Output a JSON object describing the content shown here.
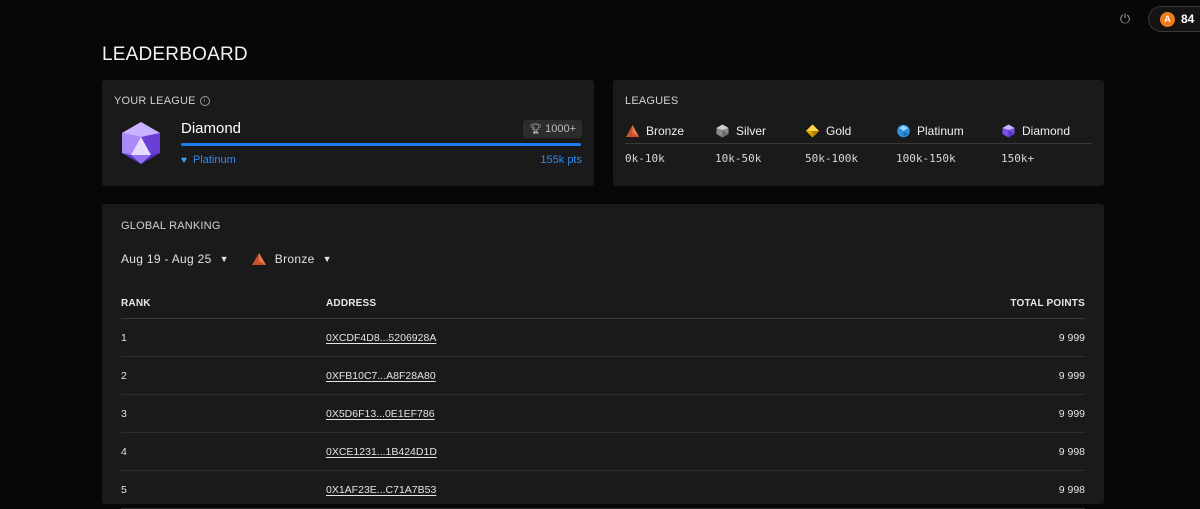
{
  "header": {
    "avatar_initial": "A",
    "balance_text": "84"
  },
  "page": {
    "title": "LEADERBOARD"
  },
  "your_league": {
    "label": "YOUR LEAGUE",
    "league_name": "Diamond",
    "badge": "1000+",
    "next_league": "Platinum",
    "points": "155k pts",
    "progress_percent": 100
  },
  "leagues": {
    "label": "LEAGUES",
    "items": [
      {
        "name": "Bronze",
        "range": "0k-10k",
        "icon": "bronze-triangle-icon",
        "color": "#d8603a"
      },
      {
        "name": "Silver",
        "range": "10k-50k",
        "icon": "silver-gem-icon",
        "color": "#9a9a9a"
      },
      {
        "name": "Gold",
        "range": "50k-100k",
        "icon": "gold-gem-icon",
        "color": "#f0b400"
      },
      {
        "name": "Platinum",
        "range": "100k-150k",
        "icon": "platinum-gem-icon",
        "color": "#43a6e8"
      },
      {
        "name": "Diamond",
        "range": "150k+",
        "icon": "diamond-gem-icon",
        "color": "#8b5cf6"
      }
    ]
  },
  "ranking": {
    "label": "GLOBAL RANKING",
    "date_filter": "Aug 19 - Aug 25",
    "league_filter": "Bronze",
    "columns": {
      "rank": "RANK",
      "address": "ADDRESS",
      "points": "TOTAL POINTS"
    },
    "rows": [
      {
        "rank": "1",
        "address": "0XCDF4D8...5206928A",
        "points": "9 999"
      },
      {
        "rank": "2",
        "address": "0XFB10C7...A8F28A80",
        "points": "9 999"
      },
      {
        "rank": "3",
        "address": "0X5D6F13...0E1EF786",
        "points": "9 999"
      },
      {
        "rank": "4",
        "address": "0XCE1231...1B424D1D",
        "points": "9 998"
      },
      {
        "rank": "5",
        "address": "0X1AF23E...C71A7B53",
        "points": "9 998"
      }
    ]
  }
}
